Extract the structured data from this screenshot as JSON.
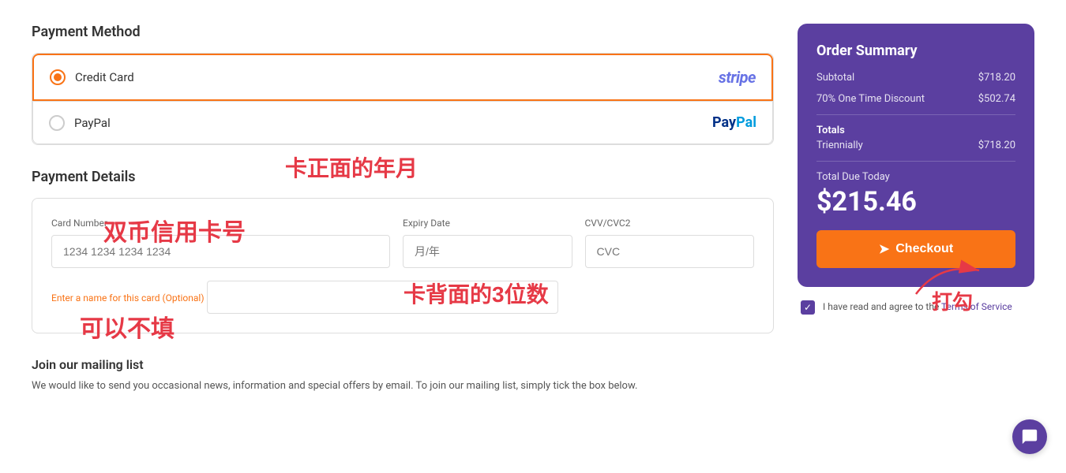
{
  "page": {
    "payment_method": {
      "title": "Payment Method",
      "options": [
        {
          "id": "credit-card",
          "label": "Credit Card",
          "selected": true,
          "logo": "stripe"
        },
        {
          "id": "paypal",
          "label": "PayPal",
          "selected": false,
          "logo": "paypal"
        }
      ]
    },
    "payment_details": {
      "title": "Payment Details",
      "card_number": {
        "label": "Card Number",
        "placeholder": "1234 1234 1234 1234"
      },
      "expiry": {
        "label": "Expiry Date",
        "placeholder": "月/年"
      },
      "cvc": {
        "label": "CVV/CVC2",
        "placeholder": "CVC"
      },
      "name_label": "Enter a name for this card (Optional)",
      "name_placeholder": ""
    },
    "mailing": {
      "title": "Join our mailing list",
      "text": "We would like to send you occasional news, information and special offers by email. To join our mailing list, simply tick the box below."
    },
    "annotations": [
      {
        "id": "card-number-annot",
        "text": "双币信用卡号",
        "top": "295",
        "left": "140"
      },
      {
        "id": "expiry-annot",
        "text": "卡正面的年月",
        "top": "240",
        "left": "390"
      },
      {
        "id": "cvc-annot",
        "text": "卡背面的3位数",
        "top": "380",
        "left": "590"
      },
      {
        "id": "optional-annot",
        "text": "可以不填",
        "top": "415",
        "left": "100"
      }
    ],
    "order_summary": {
      "title": "Order Summary",
      "subtotal_label": "Subtotal",
      "subtotal_value": "$718.20",
      "discount_label": "70% One Time Discount",
      "discount_value": "$502.74",
      "totals_label": "Totals",
      "triennially_label": "Triennially",
      "triennially_value": "$718.20",
      "total_due_label": "Total Due Today",
      "total_due_amount": "$215.46",
      "checkout_label": "Checkout"
    },
    "terms": {
      "text": "I have read and agree to the ",
      "link_text": "Terms of Service",
      "checked": true
    }
  }
}
